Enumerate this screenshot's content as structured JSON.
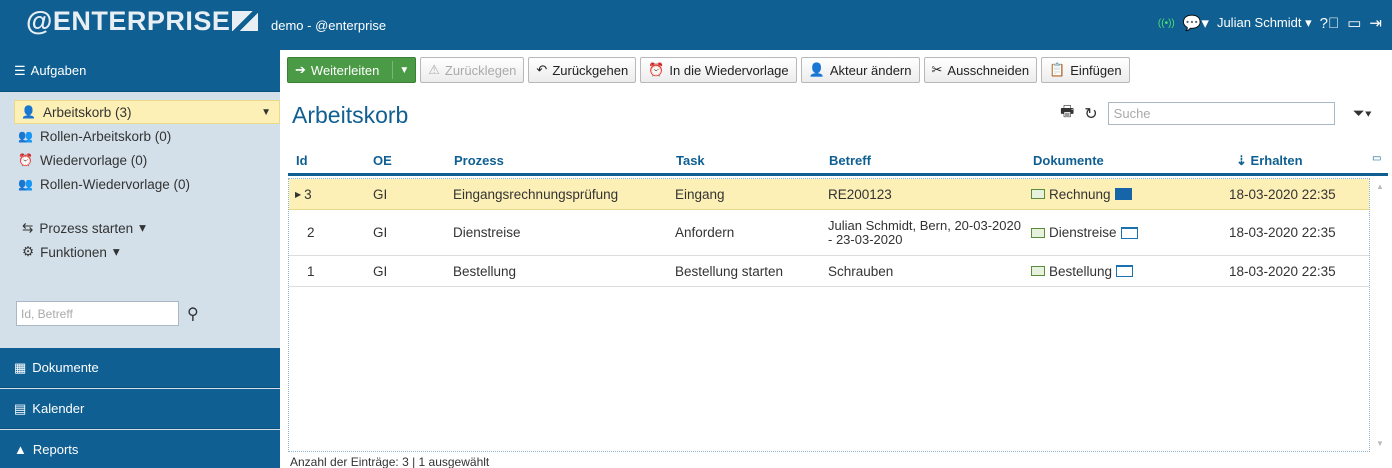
{
  "header": {
    "logo": "@ENTERPRISE",
    "title": "demo - @enterprise",
    "user": "Julian Schmidt"
  },
  "sidebar": {
    "section_title": "Aufgaben",
    "items": [
      {
        "label": "Arbeitskorb (3)",
        "icon": "user-icon"
      },
      {
        "label": "Rollen-Arbeitskorb (0)",
        "icon": "users-icon"
      },
      {
        "label": "Wiedervorlage (0)",
        "icon": "alarm-clock-icon"
      },
      {
        "label": "Rollen-Wiedervorlage (0)",
        "icon": "users-icon"
      }
    ],
    "start_process": "Prozess starten",
    "functions": "Funktionen",
    "search_placeholder": "Id, Betreff",
    "nav": [
      "Dokumente",
      "Kalender",
      "Reports"
    ]
  },
  "toolbar": {
    "forward": "Weiterleiten",
    "putback": "Zurücklegen",
    "goback": "Zurückgehen",
    "resubmit": "In die Wiedervorlage",
    "change_actor": "Akteur ändern",
    "cut": "Ausschneiden",
    "paste": "Einfügen"
  },
  "main": {
    "title": "Arbeitskorb",
    "search_placeholder": "Suche",
    "columns": [
      "Id",
      "OE",
      "Prozess",
      "Task",
      "Betreff",
      "Dokumente",
      "Erhalten"
    ],
    "rows": [
      {
        "id": "3",
        "oe": "GI",
        "prozess": "Eingangsrechnungsprüfung",
        "task": "Eingang",
        "betreff": "RE200123",
        "dokument": "Rechnung",
        "erhalten": "18-03-2020 22:35",
        "selected": true
      },
      {
        "id": "2",
        "oe": "GI",
        "prozess": "Dienstreise",
        "task": "Anfordern",
        "betreff": "Julian Schmidt, Bern, 20-03-2020 - 23-03-2020",
        "dokument": "Dienstreise",
        "erhalten": "18-03-2020 22:35",
        "selected": false
      },
      {
        "id": "1",
        "oe": "GI",
        "prozess": "Bestellung",
        "task": "Bestellung starten",
        "betreff": "Schrauben",
        "dokument": "Bestellung",
        "erhalten": "18-03-2020 22:35",
        "selected": false
      }
    ],
    "footer": "Anzahl der Einträge: 3 | 1 ausgewählt"
  }
}
